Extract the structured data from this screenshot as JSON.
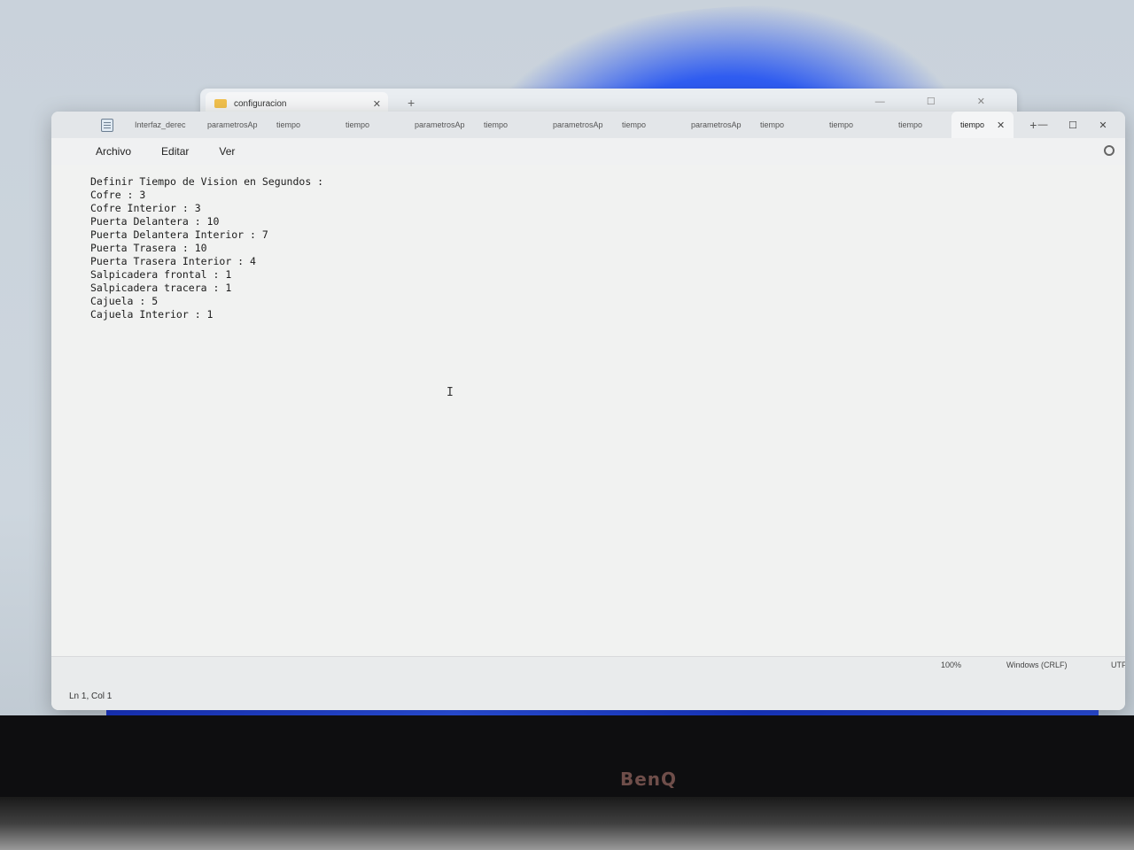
{
  "back_window": {
    "tab_label": "configuracion"
  },
  "notepad": {
    "tabs": [
      {
        "label": "Interfaz_derec"
      },
      {
        "label": "parametrosAp"
      },
      {
        "label": "tiempo"
      },
      {
        "label": "tiempo"
      },
      {
        "label": "parametrosAp"
      },
      {
        "label": "tiempo"
      },
      {
        "label": "parametrosAp"
      },
      {
        "label": "tiempo"
      },
      {
        "label": "parametrosAp"
      },
      {
        "label": "tiempo"
      },
      {
        "label": "tiempo"
      },
      {
        "label": "tiempo"
      }
    ],
    "active_tab": "tiempo",
    "menu": [
      "Archivo",
      "Editar",
      "Ver"
    ],
    "content_lines": [
      "Definir Tiempo de Vision en Segundos :",
      "Cofre : 3",
      "Cofre Interior : 3",
      "Puerta Delantera : 10",
      "Puerta Delantera Interior : 7",
      "Puerta Trasera : 10",
      "Puerta Trasera Interior : 4",
      "Salpicadera frontal : 1",
      "Salpicadera tracera : 1",
      "Cajuela : 5",
      "Cajuela Interior : 1"
    ],
    "status": {
      "position": "Ln 1, Col 1",
      "zoom": "100%",
      "line_ending": "Windows (CRLF)",
      "encoding": "UTF"
    }
  },
  "monitor": {
    "brand": "BenQ"
  },
  "icons": {
    "tab_close": "✕",
    "tab_add": "+",
    "minimize": "—",
    "maximize": "☐",
    "close": "✕",
    "ibeam": "I"
  }
}
